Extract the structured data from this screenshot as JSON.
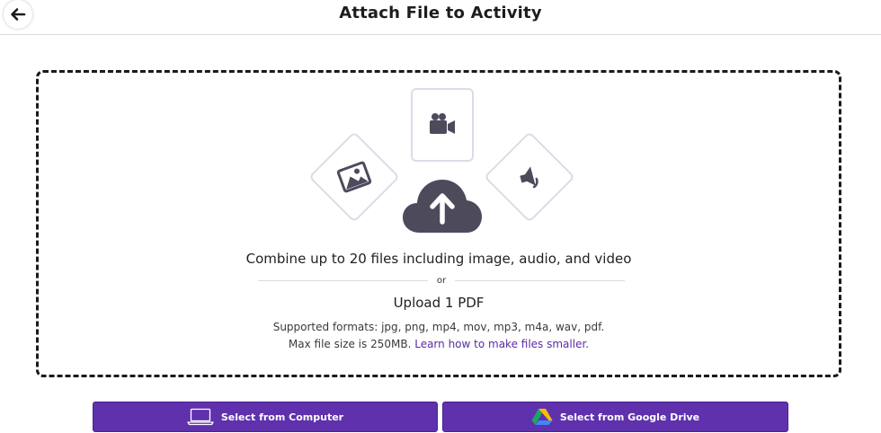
{
  "header": {
    "title": "Attach File to Activity",
    "back_icon": "arrow-left-icon"
  },
  "dropzone": {
    "icons": [
      "video-camera-icon",
      "image-icon",
      "audio-icon",
      "cloud-upload-icon"
    ],
    "headline": "Combine up to 20 files including image, audio, and video",
    "or_text": "or",
    "upload_pdf": "Upload 1 PDF",
    "formats_text": "Supported formats: jpg, png, mp4, mov, mp3, m4a, wav, pdf.",
    "max_size_text": "Max file size is 250MB.",
    "learn_link": "Learn how to make files smaller."
  },
  "buttons": {
    "computer_label": "Select from Computer",
    "drive_label": "Select from Google Drive"
  },
  "colors": {
    "accent": "#5f31ad",
    "link": "#5b2aa6",
    "icon": "#4d4a5c"
  }
}
